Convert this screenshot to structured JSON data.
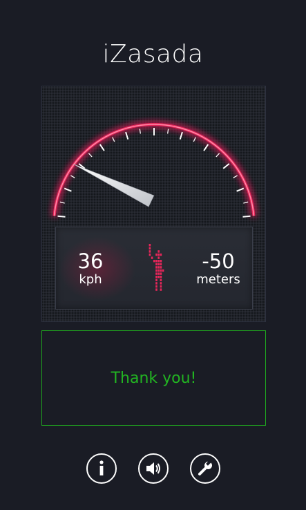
{
  "app": {
    "title": "iZasada"
  },
  "gauge": {
    "speed_value": "36",
    "speed_unit": "kph",
    "distance_value": "-50",
    "distance_unit": "meters",
    "needle_level_percent": 12,
    "accent_color": "#e8265a"
  },
  "ad": {
    "text": "Thank you!",
    "color": "#22b422"
  },
  "toolbar": {
    "buttons": [
      {
        "icon": "info-icon"
      },
      {
        "icon": "speaker-icon"
      },
      {
        "icon": "wrench-icon"
      }
    ]
  }
}
